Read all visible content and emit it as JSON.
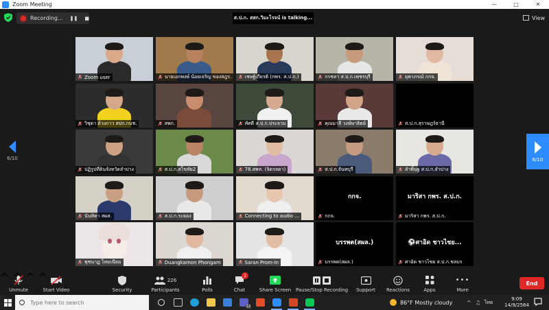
{
  "window": {
    "title": "Zoom Meeting"
  },
  "topbar": {
    "recording_label": "Recording...",
    "talking_label": "ส.ป.ก. สสก.วิมะโรจน์ is talking...",
    "view_label": "View"
  },
  "pager": {
    "left": "6/10",
    "right": "6/10"
  },
  "tiles": [
    {
      "name": "Zoom user",
      "kind": "person",
      "bg": "#c9cfd6",
      "skin": "#d9a98a",
      "shirt": "#2a2a2a"
    },
    {
      "name": "นายเอกพงษ์ น้อยเจริญ ของสฎร..",
      "kind": "person",
      "bg": "#a07a4a",
      "skin": "#b9825e",
      "shirt": "#3a5a8a"
    },
    {
      "name": "เชษฐ์เกียรติ (กพร. ส.ป.ก.)",
      "kind": "person",
      "bg": "#d8d6cc",
      "skin": "#a8744e",
      "shirt": "#2a3a5a"
    },
    {
      "name": "กรชลา ส.ป.ก.เพชรบุรี",
      "kind": "person",
      "bg": "#b7b4a8",
      "skin": "#c79a7c",
      "shirt": "#e6e6e6"
    },
    {
      "name": "ยุพาภรณ์ กกจ.",
      "kind": "person",
      "bg": "#e5ddd6",
      "skin": "#e0b9a0",
      "shirt": "#f0e4d8"
    },
    {
      "name": "วิชุดา ด้วงกาว สปก.กบช.",
      "kind": "person",
      "bg": "#2c2c2c",
      "skin": "#d4a98a",
      "shirt": "#f2d21f"
    },
    {
      "name": "สพก.",
      "kind": "person",
      "bg": "#5a4640",
      "skin": "#c88c6e",
      "shirt": "#7a4a3a"
    },
    {
      "name": "ทัศดี ส.ป.ก.ประจวบ",
      "kind": "person",
      "bg": "#3e4a3a",
      "skin": "#d6aa90",
      "shirt": "#f0f0f0"
    },
    {
      "name": "คุณมาลี วงษ์ษาธิตย์",
      "kind": "person",
      "bg": "#5a3a38",
      "skin": "#d2a488",
      "shirt": "#e9e9e9"
    },
    {
      "name": "ส.ป.ก.สุราษฎร์ธานี",
      "kind": "black"
    },
    {
      "name": "ปฏิรูปที่ดินจังหวัดลำปาง",
      "kind": "person",
      "bg": "#3a3a3a",
      "skin": "#cfa184",
      "shirt": "#333"
    },
    {
      "name": "ส.ป.ก.สโขทัย2",
      "kind": "person",
      "bg": "#6b8a4a",
      "skin": "#b98466",
      "shirt": "#d9d9d9"
    },
    {
      "name": "78.สพท. (จิตรลดา)",
      "kind": "person",
      "bg": "#dad6d4",
      "skin": "#e2bca4",
      "shirt": "#c9a6cc"
    },
    {
      "name": "ส.ป.ก.จันทบุรี",
      "kind": "person",
      "bg": "#8a7b6a",
      "skin": "#c59c80",
      "shirt": "#4a5a7a"
    },
    {
      "name": "ลำพิ้นฐ ส.ป.ก.ลำปาง",
      "kind": "person",
      "bg": "#e8e6e0",
      "skin": "#d8aa8e",
      "shirt": "#6a6aa8"
    },
    {
      "name": "นันทิตา สผส.",
      "kind": "person",
      "bg": "#d6d1c6",
      "skin": "#caa084",
      "shirt": "#2a3a6a"
    },
    {
      "name": "ส.ป.ก.ระยอง",
      "kind": "person",
      "bg": "#cfcfcf",
      "skin": "#c79a7e",
      "shirt": "#e9e9e9"
    },
    {
      "name": "Connecting to audio ...",
      "kind": "person",
      "bg": "#e2d9cf",
      "skin": "#e6c6ae",
      "shirt": "#eeeeee"
    },
    {
      "name": "กกจ.",
      "kind": "namecard",
      "card": "กกจ."
    },
    {
      "name": "มาริสา กพร. ส.ป.ก.",
      "kind": "namecard",
      "card": "มาริสา กพร. ส.ป.ก."
    },
    {
      "name": "พุชนาฏ ไหมเนียม",
      "kind": "anime",
      "bg": "#ece6e8"
    },
    {
      "name": "Duangkamon Phongam",
      "kind": "person",
      "bg": "#ddd7d2",
      "skin": "#e0b89e",
      "shirt": "#f0f0f0"
    },
    {
      "name": "Saran Prom-In",
      "kind": "person",
      "bg": "#e4e4e2",
      "skin": "#e2bea6",
      "shirt": "#f4f4f4"
    },
    {
      "name": "บรรพต(สผล.)",
      "kind": "namecard",
      "card": "บรรพต(สผล.)"
    },
    {
      "name": "ศาอิด ชาวไชย ส.ป.ก.ชลบร",
      "kind": "namecard",
      "card": "⚽ศาอิด ชาวไชย..."
    }
  ],
  "toolbar": {
    "unmute": "Unmute",
    "start_video": "Start Video",
    "security": "Security",
    "participants": "Participants",
    "participants_count": "226",
    "polls": "Polls",
    "chat": "Chat",
    "chat_badge": "1",
    "share_screen": "Share Screen",
    "pause_stop_recording": "Pause/Stop Recording",
    "support": "Support",
    "reactions": "Reactions",
    "apps": "Apps",
    "more": "More",
    "end": "End"
  },
  "taskbar": {
    "search_placeholder": "Type here to search",
    "weather_temp": "86°F",
    "weather_text": "Mostly cloudy",
    "lang": "ไทย",
    "time": "9:09",
    "date": "14/9/2564",
    "zoom_badge": "12"
  },
  "colors": {
    "accent": "#2d8cff",
    "danger": "#e02828",
    "share": "#23d959"
  }
}
